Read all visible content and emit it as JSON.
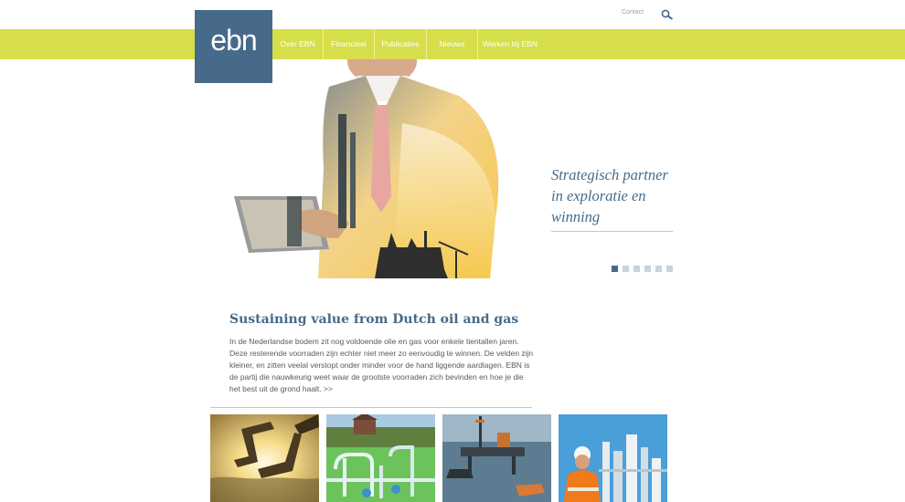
{
  "header": {
    "logo_text": "ebn",
    "contact_label": "Contact",
    "search_icon": "search-icon"
  },
  "nav": {
    "items": [
      {
        "label": "Over EBN"
      },
      {
        "label": "Financieel"
      },
      {
        "label": "Publicaties"
      },
      {
        "label": "Nieuws"
      },
      {
        "label": "Werken bij EBN"
      }
    ]
  },
  "hero": {
    "tagline": "Strategisch partner in exploratie en winning",
    "slide_count": 6,
    "active_slide": 1
  },
  "intro": {
    "heading": "Sustaining value from Dutch oil and gas",
    "body": "In de Nederlandse bodem zit nog voldoende olie en gas voor enkele tientallen jaren. Deze resterende voorraden zijn echter niet meer zo eenvoudig te winnen. De velden zijn kleiner, en zitten veelal verstopt onder minder voor de hand liggende aardlagen. EBN is de partij die nauwkeurig weet waar de grootste voorraden zich bevinden en hoe je die het best uit de grond haalt. >>"
  },
  "colors": {
    "brand_blue": "#476a8a",
    "accent_green": "#d6de4a"
  },
  "tiles": [
    {
      "icon": "sunset-hands-image"
    },
    {
      "icon": "gas-pipes-image"
    },
    {
      "icon": "offshore-platform-image"
    },
    {
      "icon": "refinery-worker-image"
    }
  ]
}
